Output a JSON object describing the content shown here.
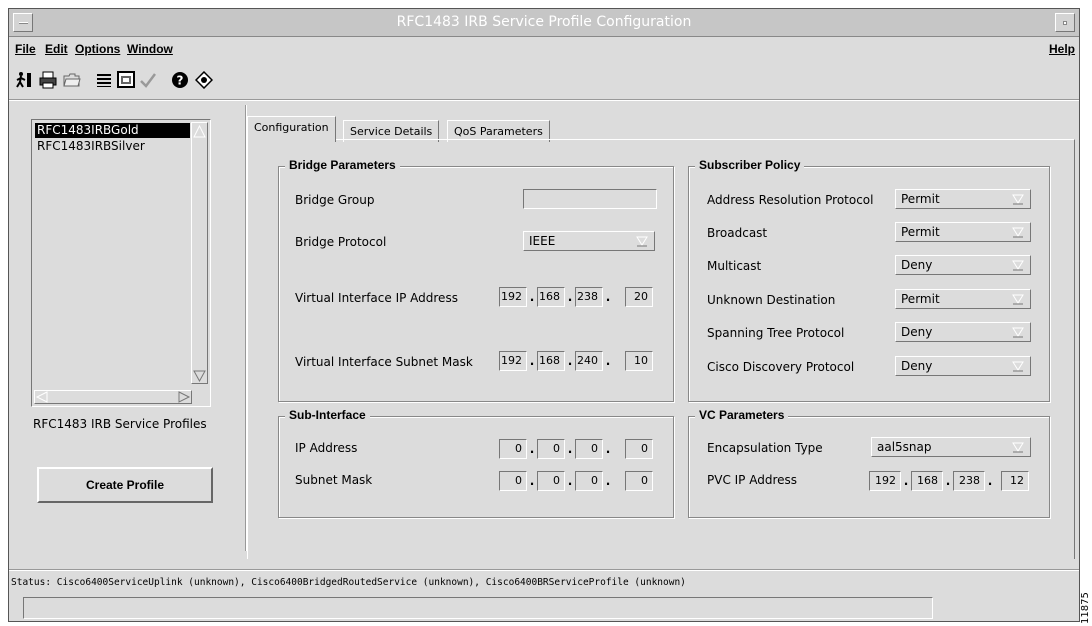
{
  "window": {
    "title": "RFC1483 IRB Service Profile Configuration"
  },
  "menu": {
    "file": "File",
    "edit": "Edit",
    "options": "Options",
    "window": "Window",
    "help": "Help"
  },
  "toolbar": {
    "icons": [
      "exit-icon",
      "print-icon",
      "open-folder-icon",
      "list-icon",
      "window-icon",
      "check-icon",
      "help-icon",
      "info-icon"
    ]
  },
  "profiles": {
    "items": [
      "RFC1483IRBGold",
      "RFC1483IRBSilver"
    ],
    "selected": "RFC1483IRBGold",
    "caption": "RFC1483 IRB Service Profiles",
    "create_button": "Create Profile"
  },
  "tabs": [
    "Configuration",
    "Service Details",
    "QoS Parameters"
  ],
  "bridge": {
    "title": "Bridge Parameters",
    "group_label": "Bridge Group",
    "group_value": "",
    "protocol_label": "Bridge Protocol",
    "protocol_value": "IEEE",
    "vif_ip_label": "Virtual Interface IP Address",
    "vif_ip": [
      "192",
      "168",
      "238",
      "20"
    ],
    "vif_mask_label": "Virtual Interface Subnet Mask",
    "vif_mask": [
      "192",
      "168",
      "240",
      "10"
    ]
  },
  "subscriber": {
    "title": "Subscriber Policy",
    "rows": [
      {
        "label": "Address Resolution Protocol",
        "value": "Permit"
      },
      {
        "label": "Broadcast",
        "value": "Permit"
      },
      {
        "label": "Multicast",
        "value": "Deny"
      },
      {
        "label": "Unknown Destination",
        "value": "Permit"
      },
      {
        "label": "Spanning Tree Protocol",
        "value": "Deny"
      },
      {
        "label": "Cisco Discovery Protocol",
        "value": "Deny"
      }
    ]
  },
  "subif": {
    "title": "Sub-Interface",
    "ip_label": "IP Address",
    "ip": [
      "0",
      "0",
      "0",
      "0"
    ],
    "mask_label": "Subnet Mask",
    "mask": [
      "0",
      "0",
      "0",
      "0"
    ]
  },
  "vc": {
    "title": "VC Parameters",
    "encap_label": "Encapsulation Type",
    "encap_value": "aal5snap",
    "pvc_label": "PVC IP Address",
    "pvc_ip": [
      "192",
      "168",
      "238",
      "12"
    ]
  },
  "status": {
    "text": "Status: Cisco6400ServiceUplink (unknown), Cisco6400BridgedRoutedService (unknown), Cisco6400BRServiceProfile (unknown)"
  },
  "side_number": "11875"
}
